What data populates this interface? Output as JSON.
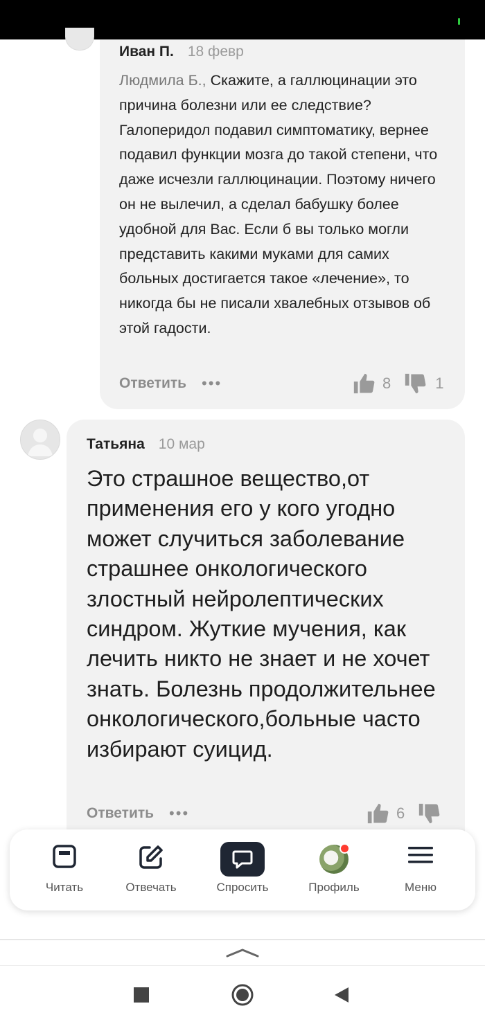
{
  "comment1": {
    "author": "Иван П.",
    "date": "18 февр",
    "mention": "Людмила Б.,",
    "text": " Скажите, а галлюцинации это причина болезни или ее следствие? Галоперидол подавил симптоматику, вернее подавил функции мозга до такой степени, что даже исчезли галлюцинации. Поэтому ничего он не вылечил, а сделал бабушку более удобной для Вас. Если б вы только могли представить какими муками для самих больных достигается такое «лечение», то никогда бы не писали хвалебных отзывов об этой гадости.",
    "reply_label": "Ответить",
    "more_label": "•••",
    "likes": "8",
    "dislikes": "1"
  },
  "comment2": {
    "author": "Татьяна",
    "date": "10 мар",
    "text": "Это страшное вещество,от применения его у кого угодно может случиться заболевание страшнее онкологического злостный нейролептических синдром. Жуткие мучения, как лечить никто не знает и не хочет знать. Болезнь продолжительнее онкологического,больные часто избирают суицид.",
    "reply_label": "Ответить",
    "more_label": "•••",
    "likes": "6"
  },
  "tabbar": {
    "items": [
      {
        "label": "Читать",
        "icon": "read-icon"
      },
      {
        "label": "Отвечать",
        "icon": "edit-icon"
      },
      {
        "label": "Спросить",
        "icon": "chat-icon"
      },
      {
        "label": "Профиль",
        "icon": "avatar"
      },
      {
        "label": "Меню",
        "icon": "menu-icon"
      }
    ]
  },
  "colors": {
    "card_bg": "#f2f2f2",
    "ask_button": "#1f2633",
    "notification": "#ff3b30"
  }
}
